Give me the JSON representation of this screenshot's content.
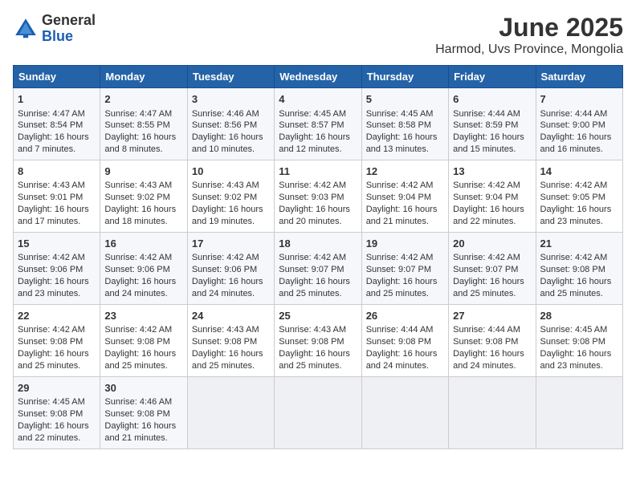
{
  "logo": {
    "general": "General",
    "blue": "Blue"
  },
  "title": "June 2025",
  "subtitle": "Harmod, Uvs Province, Mongolia",
  "days_of_week": [
    "Sunday",
    "Monday",
    "Tuesday",
    "Wednesday",
    "Thursday",
    "Friday",
    "Saturday"
  ],
  "weeks": [
    [
      {
        "day": "1",
        "sunrise": "4:47 AM",
        "sunset": "8:54 PM",
        "daylight": "16 hours and 7 minutes."
      },
      {
        "day": "2",
        "sunrise": "4:47 AM",
        "sunset": "8:55 PM",
        "daylight": "16 hours and 8 minutes."
      },
      {
        "day": "3",
        "sunrise": "4:46 AM",
        "sunset": "8:56 PM",
        "daylight": "16 hours and 10 minutes."
      },
      {
        "day": "4",
        "sunrise": "4:45 AM",
        "sunset": "8:57 PM",
        "daylight": "16 hours and 12 minutes."
      },
      {
        "day": "5",
        "sunrise": "4:45 AM",
        "sunset": "8:58 PM",
        "daylight": "16 hours and 13 minutes."
      },
      {
        "day": "6",
        "sunrise": "4:44 AM",
        "sunset": "8:59 PM",
        "daylight": "16 hours and 15 minutes."
      },
      {
        "day": "7",
        "sunrise": "4:44 AM",
        "sunset": "9:00 PM",
        "daylight": "16 hours and 16 minutes."
      }
    ],
    [
      {
        "day": "8",
        "sunrise": "4:43 AM",
        "sunset": "9:01 PM",
        "daylight": "16 hours and 17 minutes."
      },
      {
        "day": "9",
        "sunrise": "4:43 AM",
        "sunset": "9:02 PM",
        "daylight": "16 hours and 18 minutes."
      },
      {
        "day": "10",
        "sunrise": "4:43 AM",
        "sunset": "9:02 PM",
        "daylight": "16 hours and 19 minutes."
      },
      {
        "day": "11",
        "sunrise": "4:42 AM",
        "sunset": "9:03 PM",
        "daylight": "16 hours and 20 minutes."
      },
      {
        "day": "12",
        "sunrise": "4:42 AM",
        "sunset": "9:04 PM",
        "daylight": "16 hours and 21 minutes."
      },
      {
        "day": "13",
        "sunrise": "4:42 AM",
        "sunset": "9:04 PM",
        "daylight": "16 hours and 22 minutes."
      },
      {
        "day": "14",
        "sunrise": "4:42 AM",
        "sunset": "9:05 PM",
        "daylight": "16 hours and 23 minutes."
      }
    ],
    [
      {
        "day": "15",
        "sunrise": "4:42 AM",
        "sunset": "9:06 PM",
        "daylight": "16 hours and 23 minutes."
      },
      {
        "day": "16",
        "sunrise": "4:42 AM",
        "sunset": "9:06 PM",
        "daylight": "16 hours and 24 minutes."
      },
      {
        "day": "17",
        "sunrise": "4:42 AM",
        "sunset": "9:06 PM",
        "daylight": "16 hours and 24 minutes."
      },
      {
        "day": "18",
        "sunrise": "4:42 AM",
        "sunset": "9:07 PM",
        "daylight": "16 hours and 25 minutes."
      },
      {
        "day": "19",
        "sunrise": "4:42 AM",
        "sunset": "9:07 PM",
        "daylight": "16 hours and 25 minutes."
      },
      {
        "day": "20",
        "sunrise": "4:42 AM",
        "sunset": "9:07 PM",
        "daylight": "16 hours and 25 minutes."
      },
      {
        "day": "21",
        "sunrise": "4:42 AM",
        "sunset": "9:08 PM",
        "daylight": "16 hours and 25 minutes."
      }
    ],
    [
      {
        "day": "22",
        "sunrise": "4:42 AM",
        "sunset": "9:08 PM",
        "daylight": "16 hours and 25 minutes."
      },
      {
        "day": "23",
        "sunrise": "4:42 AM",
        "sunset": "9:08 PM",
        "daylight": "16 hours and 25 minutes."
      },
      {
        "day": "24",
        "sunrise": "4:43 AM",
        "sunset": "9:08 PM",
        "daylight": "16 hours and 25 minutes."
      },
      {
        "day": "25",
        "sunrise": "4:43 AM",
        "sunset": "9:08 PM",
        "daylight": "16 hours and 25 minutes."
      },
      {
        "day": "26",
        "sunrise": "4:44 AM",
        "sunset": "9:08 PM",
        "daylight": "16 hours and 24 minutes."
      },
      {
        "day": "27",
        "sunrise": "4:44 AM",
        "sunset": "9:08 PM",
        "daylight": "16 hours and 24 minutes."
      },
      {
        "day": "28",
        "sunrise": "4:45 AM",
        "sunset": "9:08 PM",
        "daylight": "16 hours and 23 minutes."
      }
    ],
    [
      {
        "day": "29",
        "sunrise": "4:45 AM",
        "sunset": "9:08 PM",
        "daylight": "16 hours and 22 minutes."
      },
      {
        "day": "30",
        "sunrise": "4:46 AM",
        "sunset": "9:08 PM",
        "daylight": "16 hours and 21 minutes."
      },
      null,
      null,
      null,
      null,
      null
    ]
  ]
}
